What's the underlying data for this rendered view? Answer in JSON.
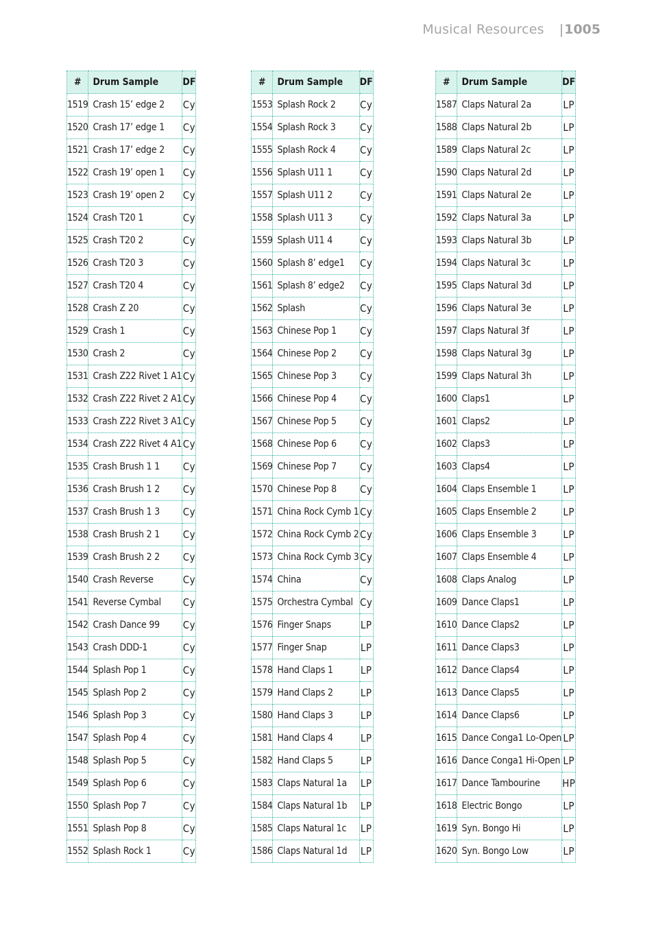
{
  "header": {
    "section": "Musical Resources",
    "page_number": "1005"
  },
  "columns": {
    "num": "#",
    "name": "Drum Sample",
    "df": "DF"
  },
  "tables": [
    {
      "rows": [
        {
          "num": "1519",
          "name": "Crash 15’ edge 2",
          "df": "Cy"
        },
        {
          "num": "1520",
          "name": "Crash 17’ edge 1",
          "df": "Cy"
        },
        {
          "num": "1521",
          "name": "Crash 17’ edge 2",
          "df": "Cy"
        },
        {
          "num": "1522",
          "name": "Crash 19’ open 1",
          "df": "Cy"
        },
        {
          "num": "1523",
          "name": "Crash 19’ open 2",
          "df": "Cy"
        },
        {
          "num": "1524",
          "name": "Crash T20 1",
          "df": "Cy"
        },
        {
          "num": "1525",
          "name": "Crash T20 2",
          "df": "Cy"
        },
        {
          "num": "1526",
          "name": "Crash T20 3",
          "df": "Cy"
        },
        {
          "num": "1527",
          "name": "Crash T20 4",
          "df": "Cy"
        },
        {
          "num": "1528",
          "name": "Crash Z 20",
          "df": "Cy"
        },
        {
          "num": "1529",
          "name": "Crash 1",
          "df": "Cy"
        },
        {
          "num": "1530",
          "name": "Crash 2",
          "df": "Cy"
        },
        {
          "num": "1531",
          "name": "Crash Z22 Rivet 1 A1",
          "df": "Cy"
        },
        {
          "num": "1532",
          "name": "Crash Z22 Rivet 2 A1",
          "df": "Cy"
        },
        {
          "num": "1533",
          "name": "Crash Z22 Rivet 3 A1",
          "df": "Cy"
        },
        {
          "num": "1534",
          "name": "Crash Z22 Rivet 4 A1",
          "df": "Cy"
        },
        {
          "num": "1535",
          "name": "Crash Brush 1 1",
          "df": "Cy"
        },
        {
          "num": "1536",
          "name": "Crash Brush 1 2",
          "df": "Cy"
        },
        {
          "num": "1537",
          "name": "Crash Brush 1 3",
          "df": "Cy"
        },
        {
          "num": "1538",
          "name": "Crash Brush 2 1",
          "df": "Cy"
        },
        {
          "num": "1539",
          "name": "Crash Brush 2 2",
          "df": "Cy"
        },
        {
          "num": "1540",
          "name": "Crash Reverse",
          "df": "Cy"
        },
        {
          "num": "1541",
          "name": "Reverse Cymbal",
          "df": "Cy"
        },
        {
          "num": "1542",
          "name": "Crash Dance 99",
          "df": "Cy"
        },
        {
          "num": "1543",
          "name": "Crash DDD-1",
          "df": "Cy"
        },
        {
          "num": "1544",
          "name": "Splash Pop 1",
          "df": "Cy"
        },
        {
          "num": "1545",
          "name": "Splash Pop 2",
          "df": "Cy"
        },
        {
          "num": "1546",
          "name": "Splash Pop 3",
          "df": "Cy"
        },
        {
          "num": "1547",
          "name": "Splash Pop 4",
          "df": "Cy"
        },
        {
          "num": "1548",
          "name": "Splash Pop 5",
          "df": "Cy"
        },
        {
          "num": "1549",
          "name": "Splash Pop 6",
          "df": "Cy"
        },
        {
          "num": "1550",
          "name": "Splash Pop 7",
          "df": "Cy"
        },
        {
          "num": "1551",
          "name": "Splash Pop 8",
          "df": "Cy"
        },
        {
          "num": "1552",
          "name": "Splash Rock 1",
          "df": "Cy"
        }
      ]
    },
    {
      "rows": [
        {
          "num": "1553",
          "name": "Splash Rock 2",
          "df": "Cy"
        },
        {
          "num": "1554",
          "name": "Splash Rock 3",
          "df": "Cy"
        },
        {
          "num": "1555",
          "name": "Splash Rock 4",
          "df": "Cy"
        },
        {
          "num": "1556",
          "name": "Splash U11 1",
          "df": "Cy"
        },
        {
          "num": "1557",
          "name": "Splash U11 2",
          "df": "Cy"
        },
        {
          "num": "1558",
          "name": "Splash U11 3",
          "df": "Cy"
        },
        {
          "num": "1559",
          "name": "Splash U11 4",
          "df": "Cy"
        },
        {
          "num": "1560",
          "name": "Splash 8’ edge1",
          "df": "Cy"
        },
        {
          "num": "1561",
          "name": "Splash 8’ edge2",
          "df": "Cy"
        },
        {
          "num": "1562",
          "name": "Splash",
          "df": "Cy"
        },
        {
          "num": "1563",
          "name": "Chinese Pop 1",
          "df": "Cy"
        },
        {
          "num": "1564",
          "name": "Chinese Pop 2",
          "df": "Cy"
        },
        {
          "num": "1565",
          "name": "Chinese Pop 3",
          "df": "Cy"
        },
        {
          "num": "1566",
          "name": "Chinese Pop 4",
          "df": "Cy"
        },
        {
          "num": "1567",
          "name": "Chinese Pop 5",
          "df": "Cy"
        },
        {
          "num": "1568",
          "name": "Chinese Pop 6",
          "df": "Cy"
        },
        {
          "num": "1569",
          "name": "Chinese Pop 7",
          "df": "Cy"
        },
        {
          "num": "1570",
          "name": "Chinese Pop 8",
          "df": "Cy"
        },
        {
          "num": "1571",
          "name": "China Rock Cymb 1",
          "df": "Cy"
        },
        {
          "num": "1572",
          "name": "China Rock Cymb 2",
          "df": "Cy"
        },
        {
          "num": "1573",
          "name": "China Rock Cymb 3",
          "df": "Cy"
        },
        {
          "num": "1574",
          "name": "China",
          "df": "Cy"
        },
        {
          "num": "1575",
          "name": "Orchestra Cymbal",
          "df": "Cy"
        },
        {
          "num": "1576",
          "name": "Finger Snaps",
          "df": "LP"
        },
        {
          "num": "1577",
          "name": "Finger Snap",
          "df": "LP"
        },
        {
          "num": "1578",
          "name": "Hand Claps 1",
          "df": "LP"
        },
        {
          "num": "1579",
          "name": "Hand Claps 2",
          "df": "LP"
        },
        {
          "num": "1580",
          "name": "Hand Claps 3",
          "df": "LP"
        },
        {
          "num": "1581",
          "name": "Hand Claps 4",
          "df": "LP"
        },
        {
          "num": "1582",
          "name": "Hand Claps 5",
          "df": "LP"
        },
        {
          "num": "1583",
          "name": "Claps Natural 1a",
          "df": "LP"
        },
        {
          "num": "1584",
          "name": "Claps Natural 1b",
          "df": "LP"
        },
        {
          "num": "1585",
          "name": "Claps Natural 1c",
          "df": "LP"
        },
        {
          "num": "1586",
          "name": "Claps Natural 1d",
          "df": "LP"
        }
      ]
    },
    {
      "rows": [
        {
          "num": "1587",
          "name": "Claps Natural 2a",
          "df": "LP"
        },
        {
          "num": "1588",
          "name": "Claps Natural 2b",
          "df": "LP"
        },
        {
          "num": "1589",
          "name": "Claps Natural 2c",
          "df": "LP"
        },
        {
          "num": "1590",
          "name": "Claps Natural 2d",
          "df": "LP"
        },
        {
          "num": "1591",
          "name": "Claps Natural 2e",
          "df": "LP"
        },
        {
          "num": "1592",
          "name": "Claps Natural 3a",
          "df": "LP"
        },
        {
          "num": "1593",
          "name": "Claps Natural 3b",
          "df": "LP"
        },
        {
          "num": "1594",
          "name": "Claps Natural 3c",
          "df": "LP"
        },
        {
          "num": "1595",
          "name": "Claps Natural 3d",
          "df": "LP"
        },
        {
          "num": "1596",
          "name": "Claps Natural 3e",
          "df": "LP"
        },
        {
          "num": "1597",
          "name": "Claps Natural 3f",
          "df": "LP"
        },
        {
          "num": "1598",
          "name": "Claps Natural 3g",
          "df": "LP"
        },
        {
          "num": "1599",
          "name": "Claps Natural 3h",
          "df": "LP"
        },
        {
          "num": "1600",
          "name": "Claps1",
          "df": "LP"
        },
        {
          "num": "1601",
          "name": "Claps2",
          "df": "LP"
        },
        {
          "num": "1602",
          "name": "Claps3",
          "df": "LP"
        },
        {
          "num": "1603",
          "name": "Claps4",
          "df": "LP"
        },
        {
          "num": "1604",
          "name": "Claps Ensemble 1",
          "df": "LP"
        },
        {
          "num": "1605",
          "name": "Claps Ensemble 2",
          "df": "LP"
        },
        {
          "num": "1606",
          "name": "Claps Ensemble 3",
          "df": "LP"
        },
        {
          "num": "1607",
          "name": "Claps Ensemble 4",
          "df": "LP"
        },
        {
          "num": "1608",
          "name": "Claps Analog",
          "df": "LP"
        },
        {
          "num": "1609",
          "name": "Dance Claps1",
          "df": "LP"
        },
        {
          "num": "1610",
          "name": "Dance Claps2",
          "df": "LP"
        },
        {
          "num": "1611",
          "name": "Dance Claps3",
          "df": "LP"
        },
        {
          "num": "1612",
          "name": "Dance Claps4",
          "df": "LP"
        },
        {
          "num": "1613",
          "name": "Dance Claps5",
          "df": "LP"
        },
        {
          "num": "1614",
          "name": "Dance Claps6",
          "df": "LP"
        },
        {
          "num": "1615",
          "name": "Dance Conga1 Lo-Open",
          "df": "LP"
        },
        {
          "num": "1616",
          "name": "Dance Conga1 Hi-Open",
          "df": "LP"
        },
        {
          "num": "1617",
          "name": "Dance Tambourine",
          "df": "HP"
        },
        {
          "num": "1618",
          "name": "Electric Bongo",
          "df": "LP"
        },
        {
          "num": "1619",
          "name": "Syn. Bongo Hi",
          "df": "LP"
        },
        {
          "num": "1620",
          "name": "Syn. Bongo Low",
          "df": "LP"
        }
      ]
    }
  ]
}
